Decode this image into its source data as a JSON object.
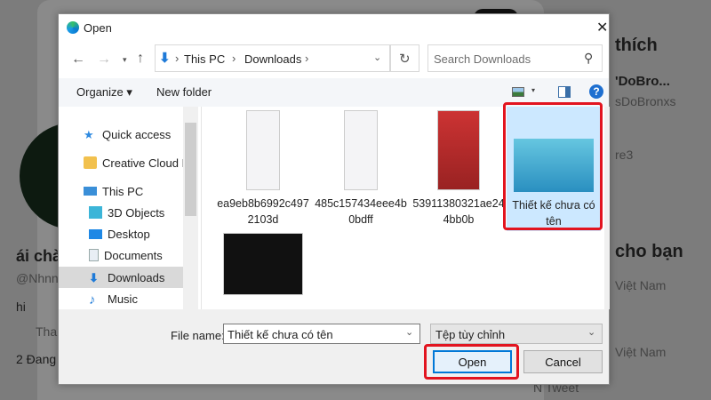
{
  "background": {
    "right_texts": [
      "thích",
      "'DoBro...",
      "sDoBronxs",
      "re3",
      "cho bạn",
      "Việt Nam",
      "Việt Nam",
      "N Tweet"
    ],
    "left_texts": [
      "ái chà",
      "@Nhnn",
      "hi",
      "Thai",
      "2 Đang"
    ]
  },
  "dialog": {
    "title": "Open",
    "close_label": "✕",
    "breadcrumb": [
      "This PC",
      "Downloads"
    ],
    "search_placeholder": "Search Downloads",
    "toolbar": {
      "organize": "Organize ▾",
      "new_folder": "New folder",
      "help": "?"
    },
    "nav": [
      {
        "label": "Quick access",
        "icon": "star-icon"
      },
      {
        "label": "Creative Cloud Files",
        "icon": "creative-cloud-icon"
      },
      {
        "label": "This PC",
        "icon": "computer-icon"
      },
      {
        "label": "3D Objects",
        "icon": "cube-icon"
      },
      {
        "label": "Desktop",
        "icon": "desktop-icon"
      },
      {
        "label": "Documents",
        "icon": "document-icon"
      },
      {
        "label": "Downloads",
        "icon": "download-icon",
        "selected": true
      },
      {
        "label": "Music",
        "icon": "music-icon"
      }
    ],
    "files": [
      {
        "name": "ea9eb8b6992c4972103d"
      },
      {
        "name": "485c157434eee4b0bdff"
      },
      {
        "name": "53911380321ae244bb0b"
      },
      {
        "name": "Thiết kế chưa có tên",
        "selected": true
      },
      {
        "name": ""
      }
    ],
    "file_name_label": "File name:",
    "file_name_value": "Thiết kế chưa có tên",
    "file_type": "Tệp tùy chỉnh",
    "open_label": "Open",
    "cancel_label": "Cancel"
  },
  "colors": {
    "accent": "#0078d7",
    "highlight": "#e2141f",
    "selection": "#cce8ff"
  }
}
